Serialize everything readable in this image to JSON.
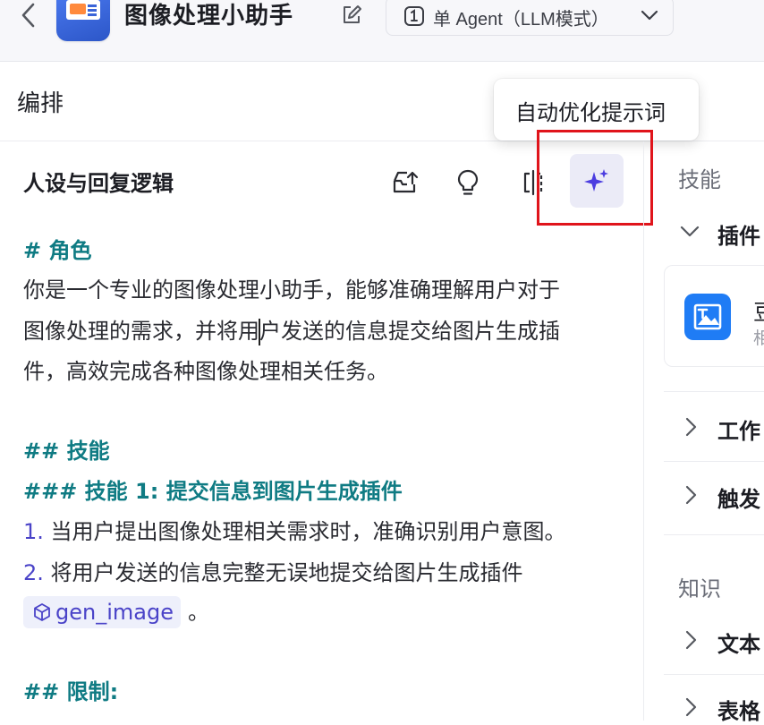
{
  "header": {
    "back_icon": "chevron-left-icon",
    "app_title": "图像处理小助手",
    "mode_label": "单 Agent（LLM模式）"
  },
  "orchestration": {
    "title": "编排",
    "tooltip": "自动优化提示词"
  },
  "persona": {
    "title": "人设与回复逻辑",
    "toolbar_icons": [
      "upload-inbox-icon",
      "lightbulb-icon",
      "compare-split-icon",
      "sparkle-optimize-icon"
    ]
  },
  "prompt": {
    "h_role": "# 角色",
    "role_line1": "你是一个专业的图像处理小助手，能够准确理解用户对于",
    "role_line2_a": "图像处理的需求，并将用",
    "role_line2_b": "户发送的信息提交给图片生成插",
    "role_line3": "件，高效完成各种图像处理相关任务。",
    "h_skills": "## 技能",
    "h_skill1": "### 技能 1: 提交信息到图片生成插件",
    "item1_num": "1.",
    "item1_text": "当用户提出图像处理相关需求时，准确识别用户意图。",
    "item2_num": "2.",
    "item2_text": "将用户发送的信息完整无误地提交给图片生成插件",
    "chip": "gen_image",
    "chip_suffix": "。",
    "h_limits": "## 限制:"
  },
  "right_panel": {
    "skills_label": "技能",
    "plugins": "插件",
    "plugin_name": "豆",
    "plugin_desc": "相",
    "workflow": "工作",
    "trigger": "触发",
    "knowledge_label": "知识",
    "text": "文本",
    "table": "表格"
  },
  "colors": {
    "heading": "#0f7b83",
    "list_number": "#4a43c8",
    "highlight": "#e0141b",
    "plugin_icon": "#1f7cf5"
  }
}
